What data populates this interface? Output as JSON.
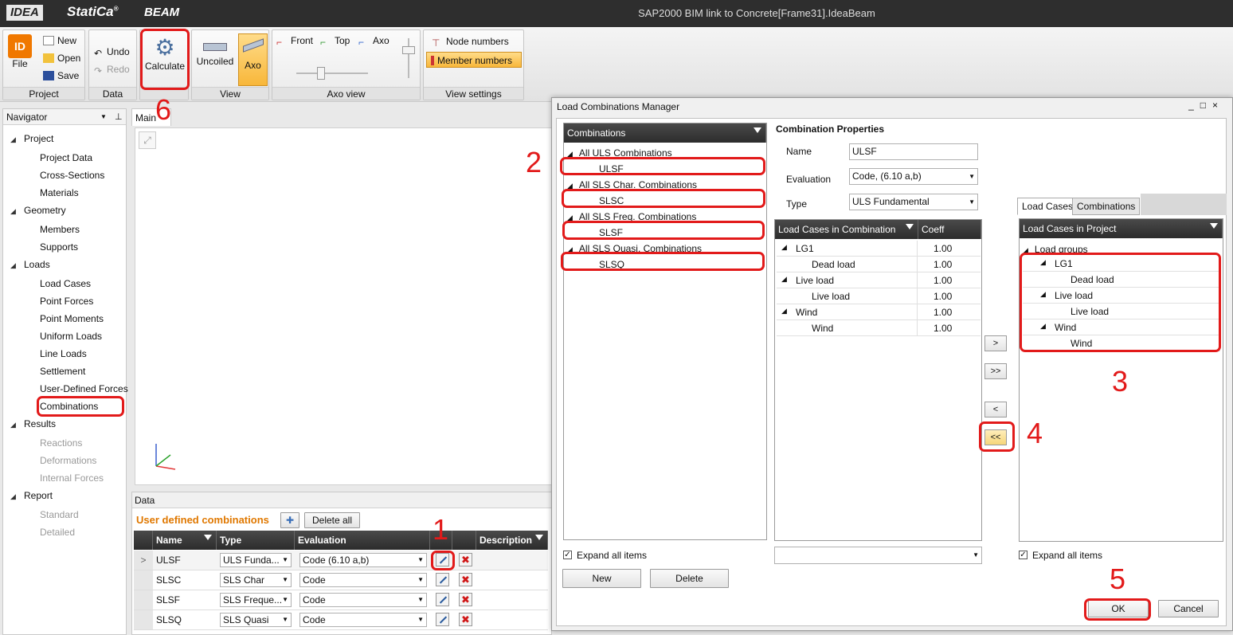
{
  "app": {
    "logo_left": "IDEA",
    "logo_brand": "StatiCa",
    "logo_reg": "®",
    "product": "BEAM",
    "title": "SAP2000 BIM link to Concrete[Frame31].IdeaBeam"
  },
  "ribbon": {
    "project": {
      "file": "File",
      "new": "New",
      "open": "Open",
      "save": "Save",
      "label": "Project"
    },
    "data": {
      "undo": "Undo",
      "redo": "Redo",
      "label": "Data"
    },
    "calc": {
      "calculate": "Calculate"
    },
    "view": {
      "uncoiled": "Uncoiled",
      "axo": "Axo",
      "label": "View"
    },
    "axoview": {
      "front": "Front",
      "top": "Top",
      "axo": "Axo",
      "label": "Axo view"
    },
    "viewsettings": {
      "node_numbers": "Node numbers",
      "member_numbers": "Member numbers",
      "label": "View settings"
    }
  },
  "navigator": {
    "title": "Navigator",
    "pin": "ᵖ",
    "items": [
      {
        "label": "Project",
        "level": 0
      },
      {
        "label": "Project Data",
        "level": 1
      },
      {
        "label": "Cross-Sections",
        "level": 1
      },
      {
        "label": "Materials",
        "level": 1
      },
      {
        "label": "Geometry",
        "level": 0
      },
      {
        "label": "Members",
        "level": 1
      },
      {
        "label": "Supports",
        "level": 1
      },
      {
        "label": "Loads",
        "level": 0
      },
      {
        "label": "Load Cases",
        "level": 1
      },
      {
        "label": "Point Forces",
        "level": 1
      },
      {
        "label": "Point Moments",
        "level": 1
      },
      {
        "label": "Uniform Loads",
        "level": 1
      },
      {
        "label": "Line Loads",
        "level": 1
      },
      {
        "label": "Settlement",
        "level": 1
      },
      {
        "label": "User-Defined Forces",
        "level": 1
      },
      {
        "label": "Combinations",
        "level": 1
      },
      {
        "label": "Results",
        "level": 0
      },
      {
        "label": "Reactions",
        "level": 1,
        "disabled": true
      },
      {
        "label": "Deformations",
        "level": 1,
        "disabled": true
      },
      {
        "label": "Internal Forces",
        "level": 1,
        "disabled": true
      },
      {
        "label": "Report",
        "level": 0
      },
      {
        "label": "Standard",
        "level": 1,
        "disabled": true
      },
      {
        "label": "Detailed",
        "level": 1,
        "disabled": true
      }
    ]
  },
  "main_tab": "Main",
  "data_panel": {
    "title": "Data",
    "heading": "User defined combinations",
    "delete_all": "Delete all",
    "columns": [
      "Name",
      "Type",
      "Evaluation",
      "Description"
    ],
    "rows": [
      {
        "marker": ">",
        "name": "ULSF",
        "type": "ULS Funda...",
        "evaluation": "Code (6.10 a,b)"
      },
      {
        "marker": "",
        "name": "SLSC",
        "type": "SLS Char",
        "evaluation": "Code"
      },
      {
        "marker": "",
        "name": "SLSF",
        "type": "SLS Freque...",
        "evaluation": "Code"
      },
      {
        "marker": "",
        "name": "SLSQ",
        "type": "SLS Quasi",
        "evaluation": "Code"
      }
    ]
  },
  "dialog": {
    "title": "Load Combinations Manager",
    "controls": "_□×",
    "combinations": {
      "header": "Combinations",
      "groups": [
        {
          "label": "All ULS Combinations",
          "item": "ULSF"
        },
        {
          "label": "All SLS Char. Combinations",
          "item": "SLSC"
        },
        {
          "label": "All SLS Freq. Combinations",
          "item": "SLSF"
        },
        {
          "label": "All SLS Quasi. Combinations",
          "item": "SLSQ"
        }
      ]
    },
    "props": {
      "title": "Combination Properties",
      "name_label": "Name",
      "name_value": "ULSF",
      "eval_label": "Evaluation",
      "eval_value": "Code, (6.10 a,b)",
      "type_label": "Type",
      "type_value": "ULS Fundamental"
    },
    "lcic": {
      "header": "Load Cases in Combination",
      "coeff": "Coeff",
      "rows": [
        {
          "label": "LG1",
          "level": 0,
          "coeff": "1.00"
        },
        {
          "label": "Dead load",
          "level": 1,
          "coeff": "1.00"
        },
        {
          "label": "Live load",
          "level": 0,
          "coeff": "1.00"
        },
        {
          "label": "Live load",
          "level": 1,
          "coeff": "1.00"
        },
        {
          "label": "Wind",
          "level": 0,
          "coeff": "1.00"
        },
        {
          "label": "Wind",
          "level": 1,
          "coeff": "1.00"
        }
      ]
    },
    "arrows": {
      "add": ">",
      "add_all": ">>",
      "remove": "<",
      "remove_all": "<<"
    },
    "tabs": {
      "load_cases": "Load Cases",
      "combinations": "Combinations"
    },
    "lcip": {
      "header": "Load Cases in Project",
      "root": "Load groups",
      "rows": [
        {
          "label": "LG1",
          "level": 1
        },
        {
          "label": "Dead load",
          "level": 2
        },
        {
          "label": "Live load",
          "level": 1
        },
        {
          "label": "Live load",
          "level": 2
        },
        {
          "label": "Wind",
          "level": 1
        },
        {
          "label": "Wind",
          "level": 2
        }
      ]
    },
    "expand_all": "Expand all items",
    "expand_all_right": "Expand all items",
    "new": "New",
    "delete": "Delete",
    "ok": "OK",
    "cancel": "Cancel"
  },
  "annotations": {
    "n1": "1",
    "n2": "2",
    "n3": "3",
    "n4": "4",
    "n5": "5",
    "n6": "6",
    "color": "#e21a1a"
  }
}
